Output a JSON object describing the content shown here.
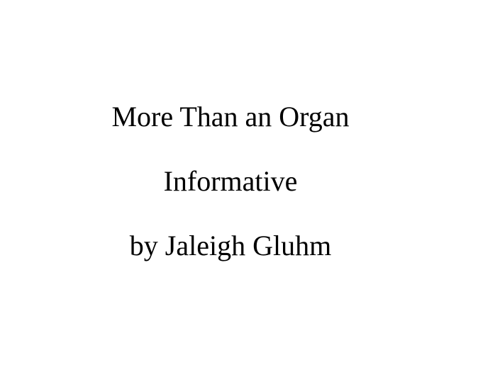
{
  "document": {
    "title": "More Than an Organ",
    "subtitle": "Informative",
    "author_line": "by Jaleigh Gluhm"
  },
  "colors": {
    "background": "#ffffff",
    "text": "#000000"
  }
}
